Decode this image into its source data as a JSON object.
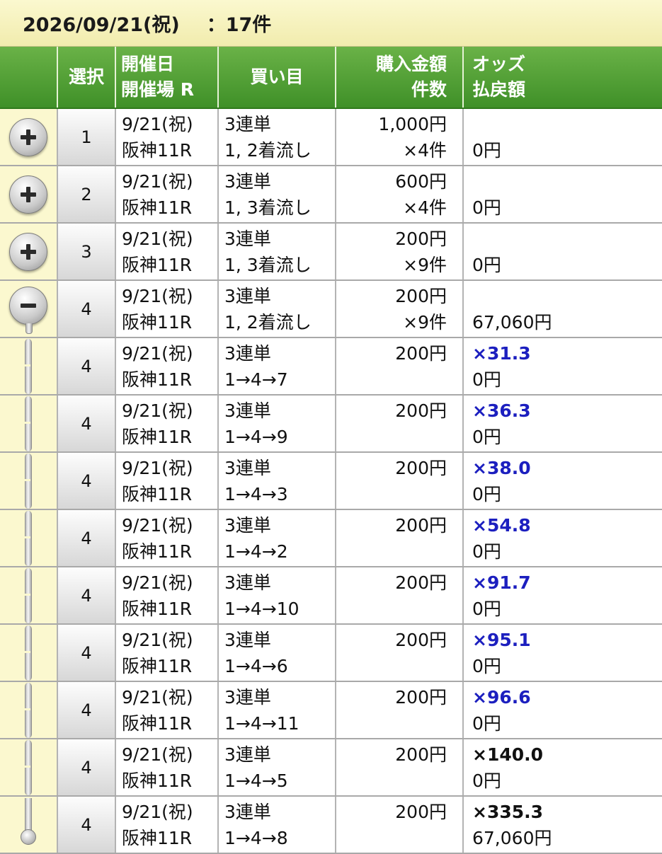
{
  "topbar": {
    "date": "2026/09/21(祝)",
    "count": "：17件"
  },
  "header": {
    "select": "選択",
    "date_line1": "開催日",
    "date_line2": "開催場 R",
    "bet": "買い目",
    "amount_line1": "購入金額",
    "amount_line2": "件数",
    "odds_line1": "オッズ",
    "odds_line2": "払戻額"
  },
  "rows": [
    {
      "icon": "plus",
      "no": "1",
      "date": "9/21(祝)",
      "venue": "阪神11R",
      "type": "3連単",
      "combo": "1, 2着流し",
      "amount": "1,000円",
      "count": "×4件",
      "odds": "",
      "payout": "0円",
      "odds_style": "none"
    },
    {
      "icon": "plus",
      "no": "2",
      "date": "9/21(祝)",
      "venue": "阪神11R",
      "type": "3連単",
      "combo": "1, 3着流し",
      "amount": "600円",
      "count": "×4件",
      "odds": "",
      "payout": "0円",
      "odds_style": "none"
    },
    {
      "icon": "plus",
      "no": "3",
      "date": "9/21(祝)",
      "venue": "阪神11R",
      "type": "3連単",
      "combo": "1, 3着流し",
      "amount": "200円",
      "count": "×9件",
      "odds": "",
      "payout": "0円",
      "odds_style": "none"
    },
    {
      "icon": "minus",
      "no": "4",
      "date": "9/21(祝)",
      "venue": "阪神11R",
      "type": "3連単",
      "combo": "1, 2着流し",
      "amount": "200円",
      "count": "×9件",
      "odds": "",
      "payout": "67,060円",
      "odds_style": "none"
    },
    {
      "icon": "pipe",
      "no": "4",
      "date": "9/21(祝)",
      "venue": "阪神11R",
      "type": "3連単",
      "combo": "1→4→7",
      "amount": "200円",
      "count": "",
      "odds": "×31.3",
      "payout": "0円",
      "odds_style": "blue"
    },
    {
      "icon": "pipe",
      "no": "4",
      "date": "9/21(祝)",
      "venue": "阪神11R",
      "type": "3連単",
      "combo": "1→4→9",
      "amount": "200円",
      "count": "",
      "odds": "×36.3",
      "payout": "0円",
      "odds_style": "blue"
    },
    {
      "icon": "pipe",
      "no": "4",
      "date": "9/21(祝)",
      "venue": "阪神11R",
      "type": "3連単",
      "combo": "1→4→3",
      "amount": "200円",
      "count": "",
      "odds": "×38.0",
      "payout": "0円",
      "odds_style": "blue"
    },
    {
      "icon": "pipe",
      "no": "4",
      "date": "9/21(祝)",
      "venue": "阪神11R",
      "type": "3連単",
      "combo": "1→4→2",
      "amount": "200円",
      "count": "",
      "odds": "×54.8",
      "payout": "0円",
      "odds_style": "blue"
    },
    {
      "icon": "pipe",
      "no": "4",
      "date": "9/21(祝)",
      "venue": "阪神11R",
      "type": "3連単",
      "combo": "1→4→10",
      "amount": "200円",
      "count": "",
      "odds": "×91.7",
      "payout": "0円",
      "odds_style": "blue"
    },
    {
      "icon": "pipe",
      "no": "4",
      "date": "9/21(祝)",
      "venue": "阪神11R",
      "type": "3連単",
      "combo": "1→4→6",
      "amount": "200円",
      "count": "",
      "odds": "×95.1",
      "payout": "0円",
      "odds_style": "blue"
    },
    {
      "icon": "pipe",
      "no": "4",
      "date": "9/21(祝)",
      "venue": "阪神11R",
      "type": "3連単",
      "combo": "1→4→11",
      "amount": "200円",
      "count": "",
      "odds": "×96.6",
      "payout": "0円",
      "odds_style": "blue"
    },
    {
      "icon": "pipe",
      "no": "4",
      "date": "9/21(祝)",
      "venue": "阪神11R",
      "type": "3連単",
      "combo": "1→4→5",
      "amount": "200円",
      "count": "",
      "odds": "×140.0",
      "payout": "0円",
      "odds_style": "black"
    },
    {
      "icon": "pipe-end",
      "no": "4",
      "date": "9/21(祝)",
      "venue": "阪神11R",
      "type": "3連単",
      "combo": "1→4→8",
      "amount": "200円",
      "count": "",
      "odds": "×335.3",
      "payout": "67,060円",
      "odds_style": "black"
    }
  ],
  "colors": {
    "header_green": "#4f9f34",
    "topbar_yellow": "#f6f2bd",
    "odds_blue": "#1c1fbf"
  }
}
